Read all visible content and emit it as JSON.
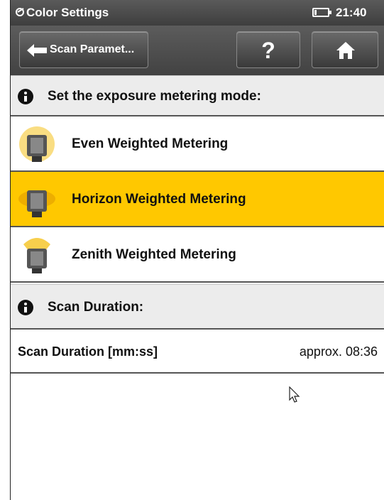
{
  "status_bar": {
    "app_title": "Color Settings",
    "time": "21:40"
  },
  "toolbar": {
    "back_label": "Scan Paramet...",
    "help_label": "?"
  },
  "metering_section": {
    "header": "Set the exposure metering mode:",
    "options": [
      {
        "label": "Even Weighted Metering",
        "icon": "even-metering-icon",
        "selected": false
      },
      {
        "label": "Horizon Weighted Metering",
        "icon": "horizon-metering-icon",
        "selected": true
      },
      {
        "label": "Zenith Weighted Metering",
        "icon": "zenith-metering-icon",
        "selected": false
      }
    ]
  },
  "duration_section": {
    "header": "Scan Duration:",
    "label": "Scan Duration [mm:ss]",
    "value": "approx. 08:36"
  },
  "colors": {
    "selection": "#ffc800",
    "toolbar": "#4a4a4a",
    "header_bg": "#ececec"
  }
}
